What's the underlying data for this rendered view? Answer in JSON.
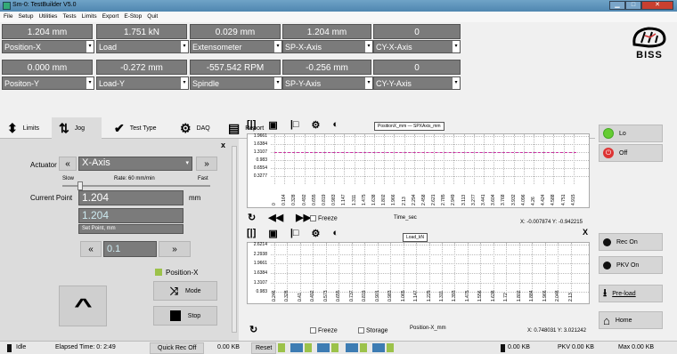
{
  "window": {
    "title": "Sm-0: TestBuilder V5.0",
    "min": "▁",
    "max": "□",
    "close": "✕"
  },
  "menu": [
    "File",
    "Setup",
    "Utilities",
    "Tests",
    "Limits",
    "Export",
    "E-Stop",
    "Quit"
  ],
  "meters_row1": [
    "1.204 mm",
    "1.751 kN",
    "0.029 mm",
    "1.204 mm",
    "0"
  ],
  "selects_row1": [
    "Position-X",
    "Load",
    "Extensometer",
    "SP-X-Axis",
    "CY-X-Axis"
  ],
  "meters_row2": [
    "0.000 mm",
    "-0.272 mm",
    "-557.542 RPM",
    "-0.256 mm",
    "0"
  ],
  "selects_row2": [
    "Positon-Y",
    "Load-Y",
    "Spindle",
    "SP-Y-Axis",
    "CY-Y-Axis"
  ],
  "logo": "BISS",
  "tabs": [
    {
      "label": "Limits",
      "icon": "⬍"
    },
    {
      "label": "Jog",
      "icon": "⇅"
    },
    {
      "label": "Test Type",
      "icon": "✔"
    },
    {
      "label": "DAQ",
      "icon": "⚙"
    },
    {
      "label": "Report",
      "icon": "▤"
    }
  ],
  "jog": {
    "actuator_label": "Actuator",
    "actuator_value": "X-Axis",
    "prev": "«",
    "next": "»",
    "slow": "Slow",
    "rate": "Rate: 60 mm/min",
    "fast": "Fast",
    "rate_level": 0.1,
    "current_point_label": "Current Point",
    "current_point": "1.204",
    "unit": "mm",
    "set_point": "1.204",
    "set_point_label": "Set Point, mm",
    "step_value": "0.1",
    "position_label": "Position-X",
    "mode_label": "Mode",
    "stop_label": "Stop",
    "up_icon": "^",
    "x_close": "x"
  },
  "plot1": {
    "legend": "PositionX_mm — SPXAxis_mm",
    "xlabel": "Time_sec",
    "coords": "X: -0.007874  Y: -0.942215",
    "freeze": "Freeze",
    "yticks": [
      "1.9661",
      "1.6384",
      "1.3107",
      "0.983",
      "0.6554",
      "0.3277"
    ],
    "xticks": [
      "0",
      "0.164",
      "0.328",
      "0.492",
      "0.655",
      "0.819",
      "0.983",
      "1.147",
      "1.311",
      "1.475",
      "1.638",
      "1.802",
      "1.966",
      "2.13",
      "2.294",
      "2.458",
      "2.621",
      "2.785",
      "2.949",
      "3.113",
      "3.277",
      "3.441",
      "3.604",
      "3.768",
      "3.932",
      "4.096",
      "4.26",
      "4.424",
      "4.588",
      "4.751",
      "4.915"
    ]
  },
  "plot2": {
    "legend": "Load_kN",
    "xlabel": "Position-X_mm",
    "coords": "X: 0.748031  Y: 3.021242",
    "freeze": "Freeze",
    "storage": "Storage",
    "yticks": [
      "2.6214",
      "2.2938",
      "1.9661",
      "1.6384",
      "1.3107",
      "0.983"
    ],
    "xticks": [
      "0.246",
      "0.328",
      "0.41",
      "0.492",
      "0.573",
      "0.655",
      "0.737",
      "0.819",
      "0.901",
      "0.983",
      "1.065",
      "1.147",
      "1.229",
      "1.311",
      "1.393",
      "1.475",
      "1.556",
      "1.638",
      "1.72",
      "1.802",
      "1.884",
      "1.966",
      "2.048",
      "2.13"
    ]
  },
  "side": {
    "lo": "Lo",
    "off": "Off",
    "x": "X",
    "rec_on": "Rec On",
    "pkv_on": "PKV On",
    "preload": "Pre-load",
    "home": "Home"
  },
  "status": {
    "state": "Idle",
    "elapsed": "Elapsed Time: 0: 2:49",
    "quick_rec": "Quick Rec Off",
    "kb1": "0.00 KB",
    "reset": "Reset",
    "kb2": "0.00 KB",
    "pkv": "PKV 0.00 KB",
    "max": "Max 0.00 KB"
  }
}
